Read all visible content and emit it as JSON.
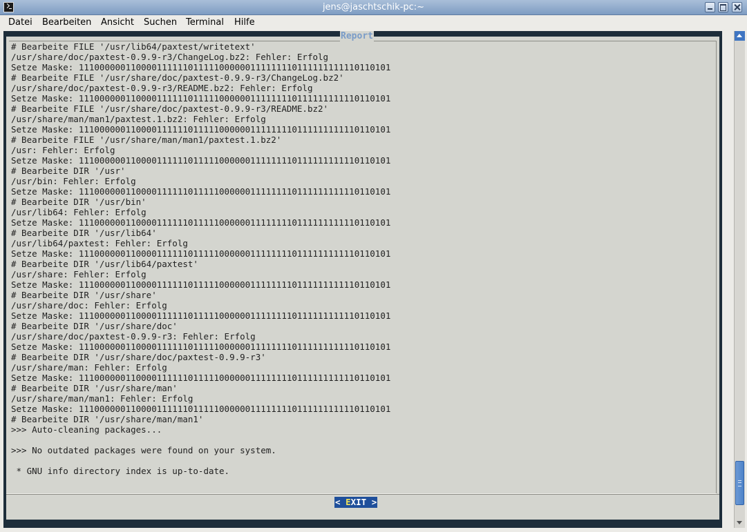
{
  "window": {
    "title": "jens@jaschtschik-pc:~"
  },
  "menu": {
    "items": [
      "Datei",
      "Bearbeiten",
      "Ansicht",
      "Suchen",
      "Terminal",
      "Hilfe"
    ]
  },
  "dialog": {
    "title": "Report",
    "exit_button": {
      "prefix": "< ",
      "hotkey": "E",
      "rest": "XIT",
      "suffix": " >"
    }
  },
  "report_lines": [
    "# Bearbeite FILE '/usr/lib64/paxtest/writetext'",
    "/usr/share/doc/paxtest-0.9.9-r3/ChangeLog.bz2: Fehler: Erfolg",
    "Setze Maske: 111000000110000111111011111000000111111110111111111110110101",
    "# Bearbeite FILE '/usr/share/doc/paxtest-0.9.9-r3/ChangeLog.bz2'",
    "/usr/share/doc/paxtest-0.9.9-r3/README.bz2: Fehler: Erfolg",
    "Setze Maske: 111000000110000111111011111000000111111110111111111110110101",
    "# Bearbeite FILE '/usr/share/doc/paxtest-0.9.9-r3/README.bz2'",
    "/usr/share/man/man1/paxtest.1.bz2: Fehler: Erfolg",
    "Setze Maske: 111000000110000111111011111000000111111110111111111110110101",
    "# Bearbeite FILE '/usr/share/man/man1/paxtest.1.bz2'",
    "/usr: Fehler: Erfolg",
    "Setze Maske: 111000000110000111111011111000000111111110111111111110110101",
    "# Bearbeite DIR '/usr'",
    "/usr/bin: Fehler: Erfolg",
    "Setze Maske: 111000000110000111111011111000000111111110111111111110110101",
    "# Bearbeite DIR '/usr/bin'",
    "/usr/lib64: Fehler: Erfolg",
    "Setze Maske: 111000000110000111111011111000000111111110111111111110110101",
    "# Bearbeite DIR '/usr/lib64'",
    "/usr/lib64/paxtest: Fehler: Erfolg",
    "Setze Maske: 111000000110000111111011111000000111111110111111111110110101",
    "# Bearbeite DIR '/usr/lib64/paxtest'",
    "/usr/share: Fehler: Erfolg",
    "Setze Maske: 111000000110000111111011111000000111111110111111111110110101",
    "# Bearbeite DIR '/usr/share'",
    "/usr/share/doc: Fehler: Erfolg",
    "Setze Maske: 111000000110000111111011111000000111111110111111111110110101",
    "# Bearbeite DIR '/usr/share/doc'",
    "/usr/share/doc/paxtest-0.9.9-r3: Fehler: Erfolg",
    "Setze Maske: 111000000110000111111011111000000111111110111111111110110101",
    "# Bearbeite DIR '/usr/share/doc/paxtest-0.9.9-r3'",
    "/usr/share/man: Fehler: Erfolg",
    "Setze Maske: 111000000110000111111011111000000111111110111111111110110101",
    "# Bearbeite DIR '/usr/share/man'",
    "/usr/share/man/man1: Fehler: Erfolg",
    "Setze Maske: 111000000110000111111011111000000111111110111111111110110101",
    "# Bearbeite DIR '/usr/share/man/man1'",
    ">>> Auto-cleaning packages...",
    "",
    ">>> No outdated packages were found on your system.",
    "",
    " * GNU info directory index is up-to-date."
  ],
  "scrollbar": {
    "position_fraction": 0.97
  }
}
